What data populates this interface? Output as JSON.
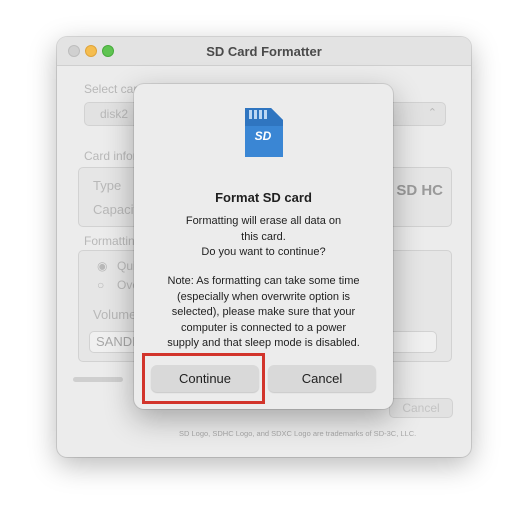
{
  "window": {
    "title": "SD Card Formatter",
    "select_card_label": "Select card",
    "selected_card": "disk2",
    "card_info_label": "Card information",
    "type_label": "Type",
    "capacity_label": "Capacity",
    "card_logo": "SD HC",
    "formatting_options_label": "Formatting options",
    "quick_label": "Quick format",
    "overwrite_label": "Overwrite format",
    "volume_label": "Volume label",
    "volume_value": "SANDISK",
    "cancel_label": "Cancel",
    "trademark_note": "SD Logo, SDHC Logo, and SDXC Logo are trademarks of SD-3C, LLC."
  },
  "dialog": {
    "title": "Format SD card",
    "message_lines": [
      "Formatting will erase all data on",
      "this card.",
      "Do you want to continue?"
    ],
    "note_lines": [
      "Note: As formatting can take some time",
      "(especially when overwrite option is",
      "selected), please make sure that your",
      "computer is connected to a power",
      "supply and that sleep mode is disabled."
    ],
    "continue_label": "Continue",
    "cancel_label": "Cancel",
    "icon": "sd-card-icon",
    "icon_text": "SD"
  },
  "colors": {
    "highlight": "#d2342b",
    "sd_icon": "#3a86d4"
  }
}
